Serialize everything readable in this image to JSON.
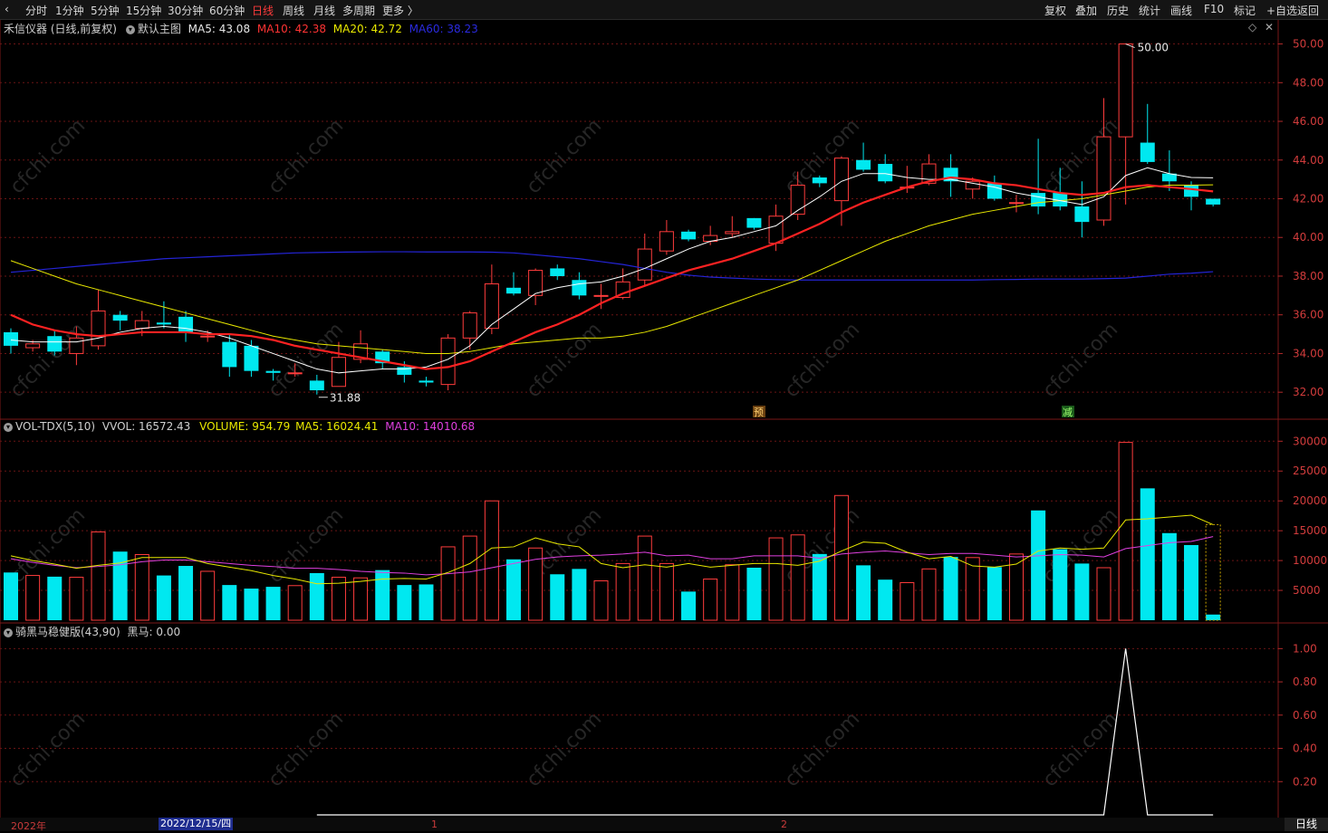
{
  "toolbar": {
    "left": [
      "分时",
      "1分钟",
      "5分钟",
      "15分钟",
      "30分钟",
      "60分钟",
      "日线",
      "周线",
      "月线",
      "多周期",
      "更多 〉"
    ],
    "right": [
      "复权",
      "叠加",
      "历史",
      "统计",
      "画线",
      "F10",
      "标记",
      "+自选",
      "返回"
    ],
    "active": "日线"
  },
  "main": {
    "stock": "禾信仪器 (日线,前复权)",
    "template": "默认主图",
    "ma5": "MA5: 43.08",
    "ma10": "MA10: 42.38",
    "ma20": "MA20: 42.72",
    "ma60": "MA60: 38.23",
    "high_label": "50.00",
    "low_label": "31.88",
    "marker_yu": "预",
    "marker_jian": "减",
    "yticks": [
      "50.00",
      "48.00",
      "46.00",
      "44.00",
      "42.00",
      "40.00",
      "38.00",
      "36.00",
      "34.00",
      "32.00"
    ]
  },
  "vol": {
    "name": "VOL-TDX(5,10)",
    "vvol": "VVOL: 16572.43",
    "volume": "VOLUME: 954.79",
    "ma5": "MA5: 16024.41",
    "ma10": "MA10: 14010.68",
    "yticks": [
      "30000",
      "25000",
      "20000",
      "15000",
      "10000",
      "5000"
    ]
  },
  "ind": {
    "name": "骑黑马稳健版(43,90)",
    "value": "黑马: 0.00",
    "yticks": [
      "1.00",
      "0.80",
      "0.60",
      "0.40",
      "0.20"
    ]
  },
  "xaxis": {
    "year": "2022年",
    "current": "2022/12/15/四",
    "m1": "1",
    "m2": "2"
  },
  "period_label": "日线",
  "watermark": "cfchi.com",
  "colors": {
    "up": "#ff3c3c",
    "down": "#00e8f0",
    "ma5": "#ffffff",
    "ma10": "#ff2222",
    "ma20": "#e8e800",
    "ma60": "#2424d8",
    "vma5": "#e8e800",
    "vma10": "#e040e0",
    "grid": "#6a1414"
  },
  "chart_data": {
    "type": "candlestick",
    "candles": [
      [
        35.1,
        34.4,
        35.3,
        34.0
      ],
      [
        34.3,
        34.5,
        34.7,
        34.1
      ],
      [
        34.9,
        34.1,
        35.2,
        33.9
      ],
      [
        34.0,
        34.8,
        35.4,
        33.4
      ],
      [
        34.4,
        36.2,
        37.3,
        34.2
      ],
      [
        36.0,
        35.7,
        36.2,
        35.2
      ],
      [
        35.3,
        35.7,
        36.2,
        34.9
      ],
      [
        35.6,
        35.5,
        36.7,
        35.3
      ],
      [
        35.9,
        35.1,
        36.2,
        34.6
      ],
      [
        34.9,
        34.9,
        35.2,
        34.6
      ],
      [
        34.6,
        33.3,
        35.0,
        32.8
      ],
      [
        34.4,
        33.1,
        34.7,
        32.8
      ],
      [
        33.1,
        33.0,
        33.2,
        32.6
      ],
      [
        33.0,
        33.0,
        33.5,
        32.8
      ],
      [
        32.6,
        32.1,
        32.9,
        31.88
      ],
      [
        32.3,
        33.8,
        34.6,
        32.3
      ],
      [
        33.7,
        34.5,
        35.2,
        33.5
      ],
      [
        34.1,
        33.5,
        34.2,
        33.2
      ],
      [
        33.3,
        32.9,
        33.6,
        32.5
      ],
      [
        32.6,
        32.5,
        32.8,
        32.3
      ],
      [
        32.4,
        34.8,
        35.0,
        32.1
      ],
      [
        34.8,
        36.1,
        36.2,
        34.2
      ],
      [
        35.3,
        37.6,
        38.6,
        35.0
      ],
      [
        37.4,
        37.1,
        38.2,
        37.0
      ],
      [
        37.0,
        38.3,
        38.4,
        36.5
      ],
      [
        38.4,
        38.0,
        38.6,
        37.8
      ],
      [
        37.8,
        37.0,
        38.2,
        36.8
      ],
      [
        37.0,
        37.0,
        37.6,
        36.3
      ],
      [
        36.9,
        37.7,
        38.4,
        36.8
      ],
      [
        37.8,
        39.4,
        40.2,
        37.5
      ],
      [
        39.3,
        40.3,
        40.9,
        39.1
      ],
      [
        40.3,
        39.9,
        40.4,
        39.8
      ],
      [
        39.8,
        40.1,
        40.6,
        39.6
      ],
      [
        40.2,
        40.3,
        41.1,
        40.0
      ],
      [
        41.0,
        40.5,
        41.0,
        40.4
      ],
      [
        39.7,
        41.1,
        41.7,
        39.3
      ],
      [
        41.2,
        42.7,
        43.4,
        40.9
      ],
      [
        43.1,
        42.8,
        43.2,
        42.6
      ],
      [
        41.9,
        44.1,
        44.2,
        40.6
      ],
      [
        44.0,
        43.5,
        44.9,
        43.4
      ],
      [
        43.8,
        42.9,
        44.3,
        42.8
      ],
      [
        42.6,
        42.6,
        43.7,
        42.3
      ],
      [
        42.8,
        43.8,
        44.3,
        42.7
      ],
      [
        43.6,
        42.9,
        44.3,
        42.1
      ],
      [
        42.5,
        42.9,
        43.1,
        42.0
      ],
      [
        42.8,
        42.0,
        43.2,
        41.9
      ],
      [
        41.8,
        41.8,
        42.2,
        41.3
      ],
      [
        42.3,
        41.6,
        45.1,
        41.2
      ],
      [
        42.3,
        41.6,
        43.6,
        41.4
      ],
      [
        41.6,
        40.8,
        42.9,
        40.0
      ],
      [
        40.9,
        45.2,
        47.2,
        40.6
      ],
      [
        45.2,
        50.0,
        50.0,
        41.7
      ],
      [
        44.9,
        43.9,
        46.9,
        43.8
      ],
      [
        43.3,
        42.9,
        44.5,
        42.4
      ],
      [
        42.7,
        42.1,
        42.9,
        41.4
      ],
      [
        42.0,
        41.7,
        42.0,
        41.6
      ]
    ],
    "ma5": [
      34.7,
      34.6,
      34.6,
      34.6,
      34.8,
      35.1,
      35.3,
      35.4,
      35.3,
      35.1,
      34.8,
      34.4,
      34.0,
      33.6,
      33.2,
      33.0,
      33.1,
      33.2,
      33.2,
      33.3,
      33.7,
      34.4,
      35.5,
      36.3,
      37.1,
      37.4,
      37.6,
      37.7,
      38.0,
      38.4,
      38.9,
      39.4,
      39.8,
      40.0,
      40.3,
      40.6,
      41.4,
      42.1,
      42.9,
      43.3,
      43.3,
      43.1,
      43.0,
      43.0,
      42.8,
      42.6,
      42.3,
      42.1,
      41.9,
      41.7,
      42.1,
      43.2,
      43.6,
      43.3,
      43.1,
      43.08
    ],
    "ma10": [
      36.0,
      35.5,
      35.2,
      35.0,
      34.9,
      35.0,
      35.1,
      35.1,
      35.1,
      35.0,
      35.0,
      34.9,
      34.7,
      34.4,
      34.2,
      34.0,
      33.8,
      33.6,
      33.4,
      33.2,
      33.3,
      33.6,
      34.1,
      34.6,
      35.1,
      35.5,
      36.0,
      36.6,
      37.1,
      37.5,
      37.9,
      38.3,
      38.6,
      38.9,
      39.3,
      39.7,
      40.2,
      40.7,
      41.3,
      41.8,
      42.2,
      42.6,
      42.9,
      43.1,
      43.0,
      42.8,
      42.7,
      42.5,
      42.3,
      42.2,
      42.3,
      42.6,
      42.7,
      42.6,
      42.5,
      42.38
    ],
    "ma20": [
      38.8,
      38.4,
      38.0,
      37.6,
      37.3,
      37.0,
      36.7,
      36.4,
      36.1,
      35.8,
      35.5,
      35.2,
      34.9,
      34.7,
      34.5,
      34.4,
      34.3,
      34.2,
      34.1,
      34.0,
      34.0,
      34.1,
      34.3,
      34.5,
      34.6,
      34.7,
      34.8,
      34.8,
      34.9,
      35.1,
      35.4,
      35.8,
      36.2,
      36.6,
      37.0,
      37.4,
      37.8,
      38.3,
      38.8,
      39.3,
      39.8,
      40.2,
      40.6,
      40.9,
      41.2,
      41.4,
      41.6,
      41.8,
      41.9,
      42.0,
      42.2,
      42.4,
      42.6,
      42.7,
      42.7,
      42.72
    ],
    "ma60": [
      38.2,
      38.3,
      38.4,
      38.5,
      38.6,
      38.7,
      38.8,
      38.9,
      38.95,
      39.0,
      39.05,
      39.1,
      39.15,
      39.2,
      39.22,
      39.24,
      39.25,
      39.26,
      39.26,
      39.25,
      39.25,
      39.25,
      39.24,
      39.2,
      39.1,
      39.0,
      38.9,
      38.75,
      38.6,
      38.4,
      38.2,
      38.05,
      37.95,
      37.9,
      37.85,
      37.82,
      37.8,
      37.8,
      37.8,
      37.8,
      37.8,
      37.8,
      37.8,
      37.8,
      37.8,
      37.82,
      37.83,
      37.85,
      37.85,
      37.85,
      37.87,
      37.9,
      38.0,
      38.1,
      38.15,
      38.23
    ],
    "volume": [
      8000,
      7500,
      7300,
      7200,
      14800,
      11500,
      11000,
      7500,
      9100,
      8200,
      5900,
      5300,
      5600,
      5800,
      7900,
      7200,
      7100,
      8400,
      5900,
      6000,
      12300,
      14100,
      20000,
      10200,
      12100,
      7700,
      8600,
      6600,
      9500,
      14100,
      9500,
      4800,
      6900,
      9300,
      8800,
      13800,
      14300,
      11100,
      20900,
      9200,
      6800,
      6300,
      8600,
      10600,
      10500,
      8900,
      11100,
      18400,
      11900,
      9500,
      8800,
      29800,
      22100,
      14600,
      12600,
      950
    ],
    "vma5": [
      10800,
      10000,
      9400,
      8700,
      9200,
      9600,
      10500,
      10500,
      10500,
      9500,
      8900,
      8300,
      7500,
      6900,
      6100,
      6200,
      6500,
      6900,
      7000,
      6900,
      8000,
      9500,
      12100,
      12300,
      13800,
      12800,
      12300,
      9500,
      8800,
      9300,
      8900,
      9500,
      8900,
      9200,
      9500,
      9500,
      9200,
      9900,
      11600,
      13100,
      12900,
      11400,
      10300,
      10700,
      9100,
      8900,
      9400,
      11600,
      12100,
      11900,
      12100,
      16800,
      17000,
      17300,
      17600,
      16024
    ],
    "vma10": [
      10300,
      9700,
      9200,
      8800,
      9000,
      9300,
      9800,
      10100,
      10100,
      9800,
      9500,
      9200,
      9000,
      8700,
      8700,
      8500,
      8200,
      8000,
      7900,
      7600,
      7800,
      8100,
      8800,
      9500,
      10200,
      10600,
      10800,
      10900,
      11100,
      11400,
      10800,
      10900,
      10300,
      10300,
      10800,
      10800,
      10800,
      10400,
      11100,
      11400,
      11600,
      11300,
      11000,
      11200,
      11200,
      10900,
      10600,
      10800,
      11000,
      10900,
      10600,
      12000,
      12500,
      13000,
      13200,
      14010
    ],
    "indicator": [
      0,
      0,
      0,
      0,
      0,
      0,
      0,
      0,
      0,
      0,
      0,
      0,
      0,
      0,
      0,
      0,
      0,
      0,
      0,
      0,
      0,
      0,
      0,
      0,
      0,
      0,
      0,
      0,
      0,
      0,
      0,
      0,
      0,
      0,
      0,
      0,
      0,
      0,
      0,
      0,
      0,
      0,
      0,
      0,
      0,
      0,
      0,
      0,
      0,
      0,
      0,
      1,
      0,
      0,
      0,
      0
    ],
    "ylim_price": [
      31.4,
      50.4
    ],
    "ylim_volume": [
      0,
      30500
    ],
    "ylim_indicator": [
      0,
      1.04
    ]
  }
}
